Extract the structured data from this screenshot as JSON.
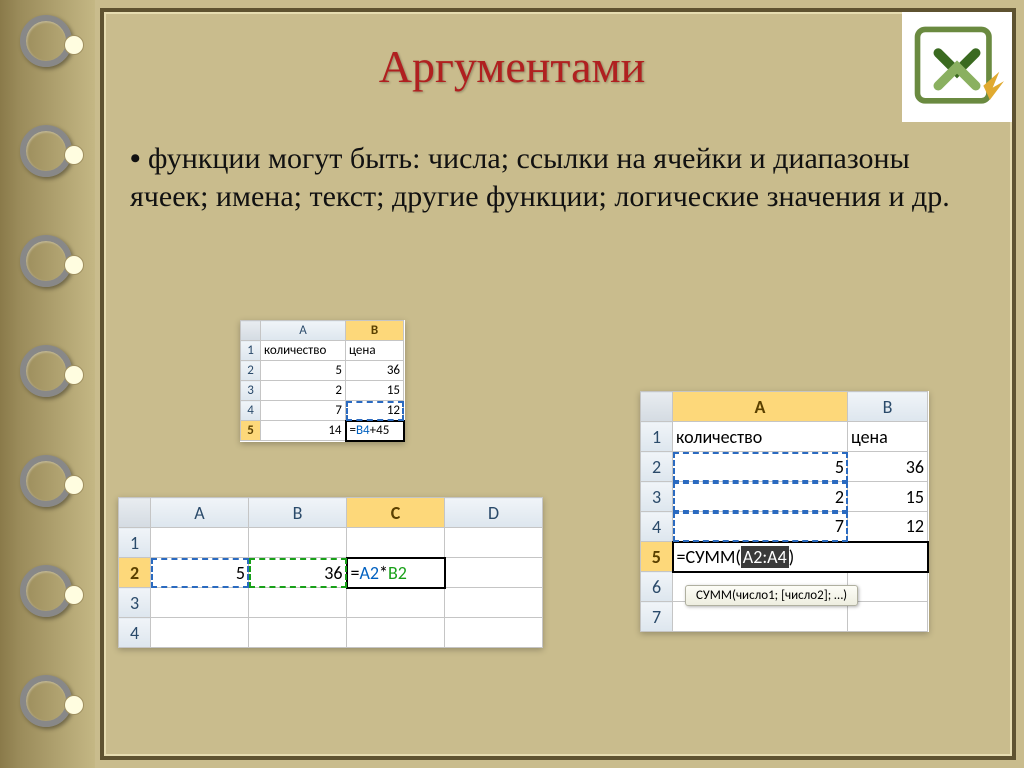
{
  "title": "Аргументами",
  "bullet": "функции могут быть: числа; ссылки на ячейки и диапазоны ячеек; имена; текст; другие функции; логические значения и др.",
  "table1": {
    "cols": [
      "A",
      "B"
    ],
    "rows": [
      {
        "n": "1",
        "a": "количество",
        "b": "цена"
      },
      {
        "n": "2",
        "a": "5",
        "b": "36"
      },
      {
        "n": "3",
        "a": "2",
        "b": "15"
      },
      {
        "n": "4",
        "a": "7",
        "b": "12"
      },
      {
        "n": "5",
        "a": "14",
        "b_formula": {
          "prefix": "=",
          "ref": "B4",
          "suffix": "+45"
        }
      }
    ]
  },
  "table2": {
    "cols": [
      "A",
      "B",
      "C",
      "D"
    ],
    "rows": [
      {
        "n": "1",
        "cells": [
          "",
          "",
          "",
          ""
        ]
      },
      {
        "n": "2",
        "cells": [
          "5",
          "36",
          "",
          ""
        ],
        "formula": {
          "prefix": "=",
          "ref1": "A2",
          "op": "*",
          "ref2": "B2"
        }
      },
      {
        "n": "3",
        "cells": [
          "",
          "",
          "",
          ""
        ]
      },
      {
        "n": "4",
        "cells": [
          "",
          "",
          "",
          ""
        ]
      }
    ]
  },
  "table3": {
    "cols": [
      "A",
      "B"
    ],
    "rows": [
      {
        "n": "1",
        "a": "количество",
        "b": "цена"
      },
      {
        "n": "2",
        "a": "5",
        "b": "36"
      },
      {
        "n": "3",
        "a": "2",
        "b": "15"
      },
      {
        "n": "4",
        "a": "7",
        "b": "12"
      },
      {
        "n": "5",
        "formula": {
          "prefix": "=СУММ(",
          "hl": "A2:A4",
          "suffix": ")"
        }
      },
      {
        "n": "6"
      },
      {
        "n": "7"
      }
    ],
    "tooltip": "СУММ(число1; [число2]; …)"
  }
}
